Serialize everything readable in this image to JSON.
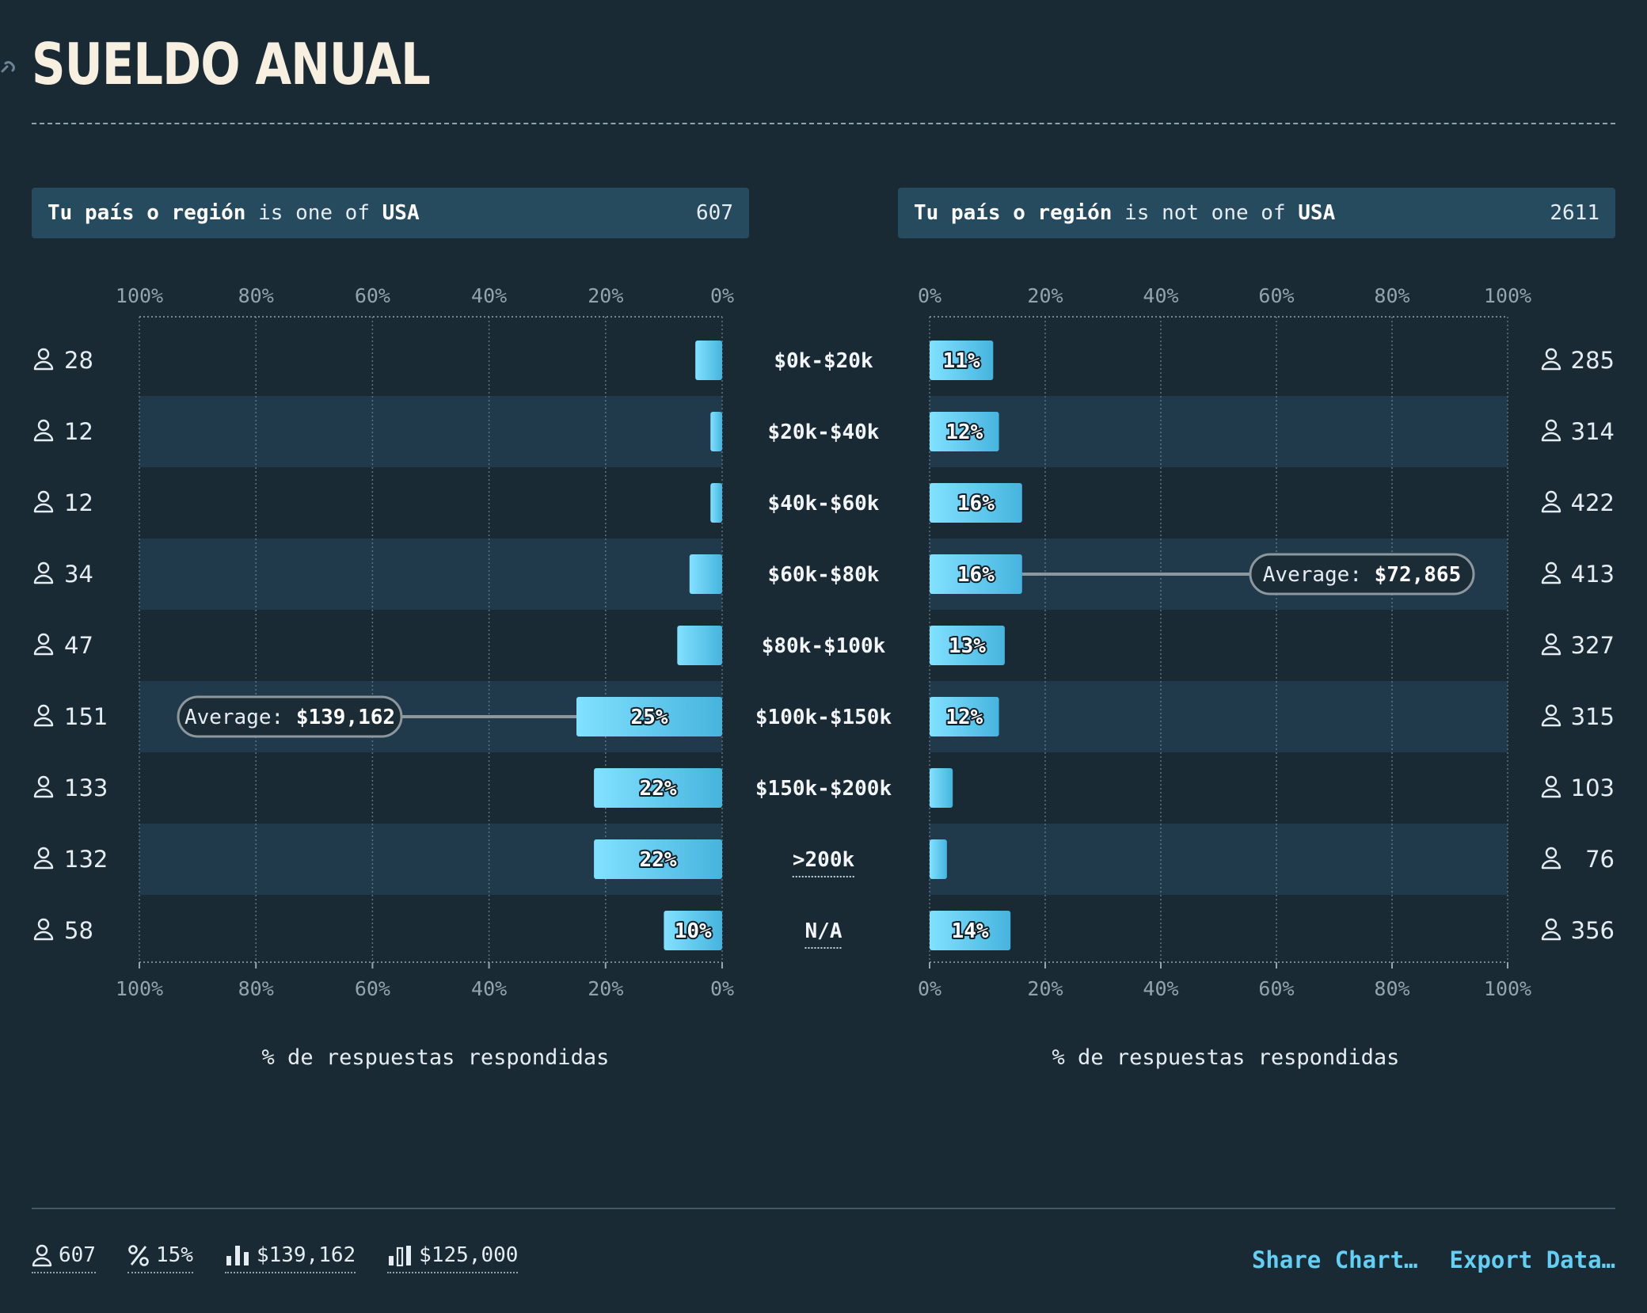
{
  "title": "SUELDO ANUAL",
  "filters": {
    "left": {
      "field": "Tu país o región",
      "op": "is one of",
      "value": "USA",
      "count": "607"
    },
    "right": {
      "field": "Tu país o región",
      "op": "is not one of",
      "value": "USA",
      "count": "2611"
    }
  },
  "chart_data": [
    {
      "type": "bar",
      "orientation": "horizontal",
      "direction": "right-to-left",
      "categories": [
        "$0k-$20k",
        "$20k-$40k",
        "$40k-$60k",
        "$60k-$80k",
        "$80k-$100k",
        "$100k-$150k",
        "$150k-$200k",
        ">200k",
        "N/A"
      ],
      "values": [
        4.6,
        2,
        2,
        5.6,
        7.7,
        25,
        22,
        22,
        10
      ],
      "data_labels": [
        "",
        "",
        "",
        "",
        "",
        "25%",
        "22%",
        "22%",
        "10%"
      ],
      "counts": [
        "28",
        "12",
        "12",
        "34",
        "47",
        "151",
        "133",
        "132",
        "58"
      ],
      "xlim": [
        0,
        100
      ],
      "ticks": [
        "100%",
        "80%",
        "60%",
        "40%",
        "20%",
        "0%"
      ],
      "xlabel": "% de respuestas respondidas",
      "average": {
        "label": "Average:",
        "value": "$139,162",
        "category_index": 5
      },
      "grid": true
    },
    {
      "type": "bar",
      "orientation": "horizontal",
      "direction": "left-to-right",
      "categories": [
        "$0k-$20k",
        "$20k-$40k",
        "$40k-$60k",
        "$60k-$80k",
        "$80k-$100k",
        "$100k-$150k",
        "$150k-$200k",
        ">200k",
        "N/A"
      ],
      "values": [
        11,
        12,
        16,
        16,
        13,
        12,
        4,
        3,
        14
      ],
      "data_labels": [
        "11%",
        "12%",
        "16%",
        "16%",
        "13%",
        "12%",
        "",
        "",
        "14%"
      ],
      "counts": [
        "285",
        "314",
        "422",
        "413",
        "327",
        "315",
        "103",
        "76",
        "356"
      ],
      "xlim": [
        0,
        100
      ],
      "ticks": [
        "0%",
        "20%",
        "40%",
        "60%",
        "80%",
        "100%"
      ],
      "xlabel": "% de respuestas respondidas",
      "average": {
        "label": "Average:",
        "value": "$72,865",
        "category_index": 3
      },
      "grid": true
    }
  ],
  "footer": {
    "respondents": "607",
    "percent": "15%",
    "average": "$139,162",
    "median": "$125,000",
    "share_label": "Share Chart…",
    "export_label": "Export Data…"
  },
  "colors": {
    "background": "#192a35",
    "band": "#203a4b",
    "bar_light": "#7fdfff",
    "bar_dark": "#45b6e0",
    "accent": "#63cff4",
    "filter_bg": "#264a5e"
  }
}
